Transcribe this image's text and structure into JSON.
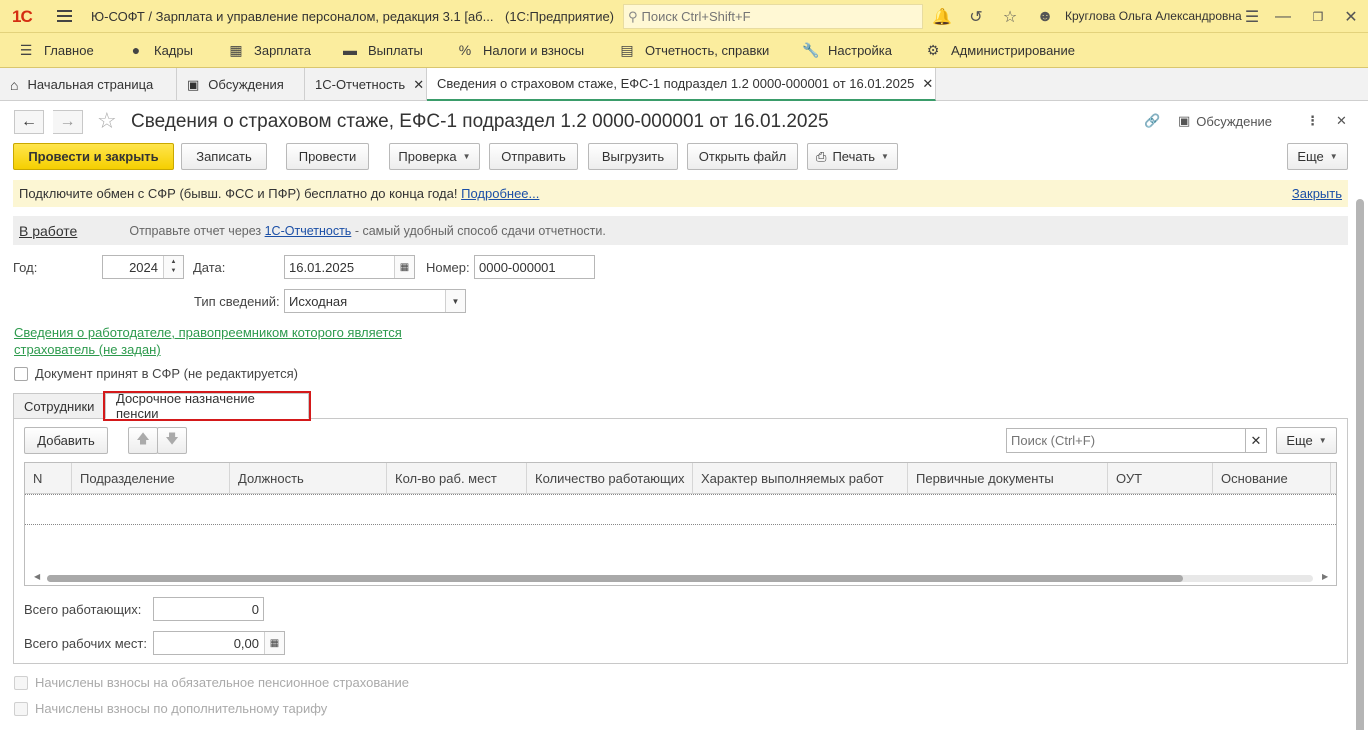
{
  "window": {
    "logo": "1С",
    "title": "Ю-СОФТ / Зарплата и управление персоналом, редакция 3.1 [аб...",
    "mode": "(1С:Предприятие)",
    "search_placeholder": "Поиск Ctrl+Shift+F",
    "user": "Круглова Ольга Александровна"
  },
  "main_menu": [
    {
      "label": "Главное",
      "icon": "menu-lines-icon"
    },
    {
      "label": "Кадры",
      "icon": "people-icon"
    },
    {
      "label": "Зарплата",
      "icon": "calculator-icon"
    },
    {
      "label": "Выплаты",
      "icon": "wallet-icon"
    },
    {
      "label": "Налоги и взносы",
      "icon": "percent-icon"
    },
    {
      "label": "Отчетность, справки",
      "icon": "report-icon"
    },
    {
      "label": "Настройка",
      "icon": "wrench-icon"
    },
    {
      "label": "Администрирование",
      "icon": "gear-icon"
    }
  ],
  "window_tabs": [
    {
      "label": "Начальная страница"
    },
    {
      "label": "Обсуждения"
    },
    {
      "label": "1С-Отчетность"
    },
    {
      "label": "Сведения о страховом стаже, ЕФС-1 подраздел 1.2 0000-000001 от 16.01.2025"
    }
  ],
  "form": {
    "title": "Сведения о страховом стаже, ЕФС-1 подраздел 1.2 0000-000001 от 16.01.2025",
    "discussion": "Обсуждение"
  },
  "commands": {
    "post_close": "Провести и закрыть",
    "save": "Записать",
    "post": "Провести",
    "check": "Проверка",
    "send": "Отправить",
    "export": "Выгрузить",
    "open_file": "Открыть файл",
    "print": "Печать",
    "more": "Еще"
  },
  "banner": {
    "text": "Подключите обмен с СФР (бывш. ФСС и ПФР) бесплатно до конца года!",
    "more_link": "Подробнее...",
    "close_link": "Закрыть"
  },
  "status": {
    "state": "В работе",
    "hint_before": "Отправьте отчет через",
    "hint_link": "1С-Отчетность",
    "hint_after": "- самый удобный способ сдачи отчетности."
  },
  "fields": {
    "year_label": "Год:",
    "year_value": "2024",
    "date_label": "Дата:",
    "date_value": "16.01.2025",
    "number_label": "Номер:",
    "number_value": "0000-000001",
    "type_label": "Тип сведений:",
    "type_value": "Исходная",
    "employer_link": "Сведения о работодателе, правопреемником которого является страхователь (не задан)",
    "accepted_checkbox": "Документ принят в СФР (не редактируется)"
  },
  "inner_tabs": [
    {
      "label": "Сотрудники"
    },
    {
      "label": "Досрочное назначение пенсии"
    }
  ],
  "table": {
    "add_button": "Добавить",
    "search_placeholder": "Поиск (Ctrl+F)",
    "more": "Еще",
    "columns": [
      "N",
      "Подразделение",
      "Должность",
      "Кол-во раб. мест",
      "Количество работающих",
      "Характер выполняемых работ",
      "Первичные документы",
      "ОУТ",
      "Основание"
    ]
  },
  "totals": {
    "workers_label": "Всего работающих:",
    "workers_value": "0",
    "places_label": "Всего рабочих мест:",
    "places_value": "0,00"
  },
  "bottom": {
    "check1": "Начислены взносы на обязательное пенсионное страхование",
    "check2": "Начислены взносы по дополнительному тарифу"
  },
  "colors": {
    "accent_yellow": "#fbed9e",
    "primary_button": "#f5cf00",
    "link_blue": "#1b4fa6",
    "link_green": "#2d9a4d",
    "highlight_red": "#d4191a"
  }
}
